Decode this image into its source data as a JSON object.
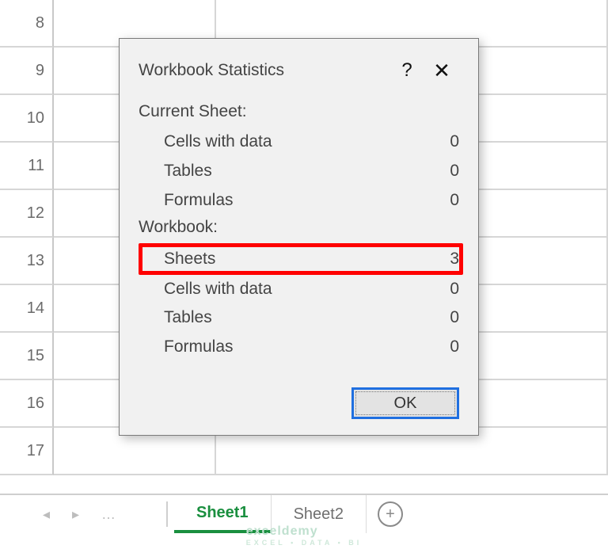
{
  "rows": [
    "8",
    "9",
    "10",
    "11",
    "12",
    "13",
    "14",
    "15",
    "16",
    "17"
  ],
  "dialog": {
    "title": "Workbook Statistics",
    "help_symbol": "?",
    "close_symbol": "✕",
    "current_sheet": {
      "heading": "Current Sheet:",
      "cells_with_data": {
        "label": "Cells with data",
        "value": "0"
      },
      "tables": {
        "label": "Tables",
        "value": "0"
      },
      "formulas": {
        "label": "Formulas",
        "value": "0"
      }
    },
    "workbook": {
      "heading": "Workbook:",
      "sheets": {
        "label": "Sheets",
        "value": "3"
      },
      "cells_with_data": {
        "label": "Cells with data",
        "value": "0"
      },
      "tables": {
        "label": "Tables",
        "value": "0"
      },
      "formulas": {
        "label": "Formulas",
        "value": "0"
      }
    },
    "ok_label": "OK"
  },
  "tabs": {
    "active": "Sheet1",
    "other": "Sheet2",
    "plus": "+"
  },
  "nav": {
    "prev": "◂",
    "next": "▸",
    "ellipsis": "…"
  },
  "watermark": {
    "brand": "exceldemy",
    "tagline": "EXCEL • DATA • BI"
  }
}
